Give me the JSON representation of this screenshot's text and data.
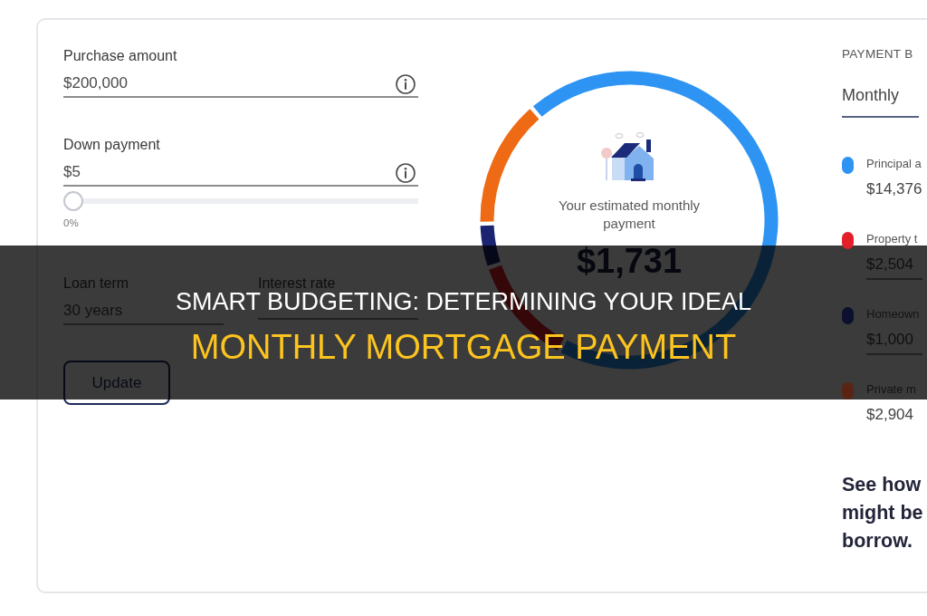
{
  "fields": [
    {
      "label": "Purchase amount",
      "value": "$200,000",
      "info_icon": true
    },
    {
      "label": "Down payment",
      "value": "$5",
      "info_icon": true,
      "slider": {
        "level": 0,
        "reading": "0%"
      }
    }
  ],
  "row_fields": [
    {
      "label": "Loan term",
      "value": "30 years",
      "info_icon": false
    },
    {
      "label": "Interest rate",
      "info_icon": false
    }
  ],
  "update_button": {
    "label": "Update"
  },
  "payment": {
    "chart_data": {
      "type": "donut",
      "values": [
        69.2,
        12.0,
        4.8,
        14.0
      ]
    },
    "caption": "Your estimated monthly payment",
    "amount": "$1,731"
  },
  "breakdown": {
    "heading": "PAYMENT B",
    "tabs": [
      {
        "label": "Monthly",
        "selected": true
      }
    ],
    "items": [
      {
        "kind": "static",
        "label": "Principal a",
        "amount": "$14,376",
        "color": "#2e94f3"
      },
      {
        "kind": "field",
        "label": "Property t",
        "amount": "$2,504",
        "color": "#e3202a"
      },
      {
        "kind": "field",
        "label": "Homeown",
        "amount": "$1,000",
        "color": "#0c102c"
      },
      {
        "kind": "static",
        "label": "Private m",
        "amount": "$2,904",
        "color": "#5a2412"
      }
    ],
    "prompt": "See how\nmight be\nborrow."
  },
  "headline": [
    {
      "text": "SMART BUDGETING: DETERMINING YOUR IDEAL",
      "highlighted": false
    },
    {
      "text": "MONTHLY MORTGAGE PAYMENT",
      "highlighted": true
    }
  ]
}
